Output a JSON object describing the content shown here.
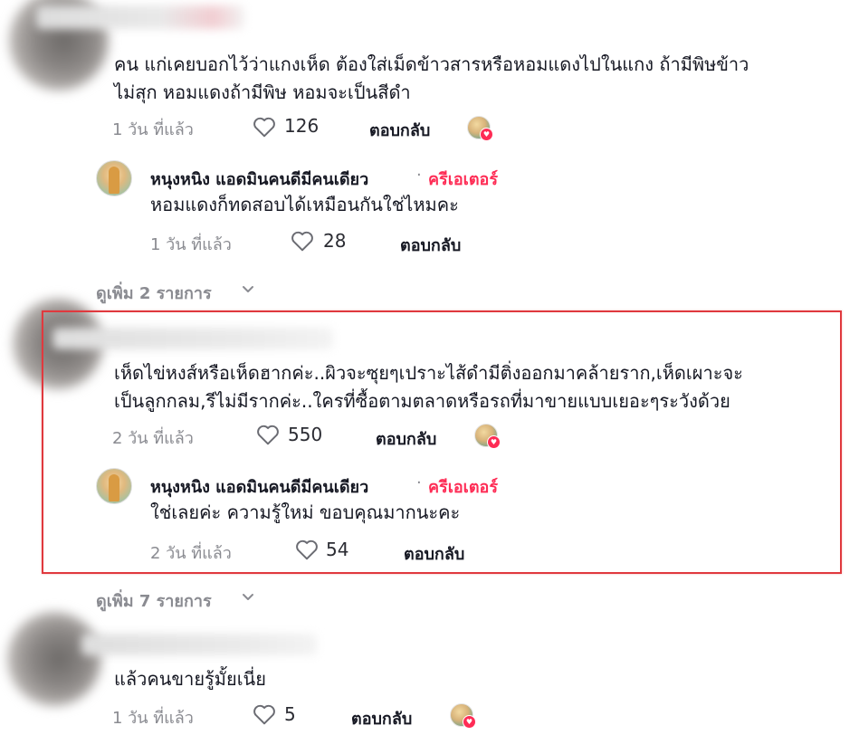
{
  "comments": [
    {
      "text_lines": [
        "คน แก่เคยบอกไว้ว่าแกงเห็ด ต้องใส่เม็ดข้าวสารหรือหอมแดงไปในแกง ถ้ามีพิษข้าว",
        "ไม่สุก หอมแดงถ้ามีพิษ หอมจะเป็นสีดำ"
      ],
      "time": "1 วัน ที่แล้ว",
      "likes": "126",
      "reply_label": "ตอบกลับ",
      "reply": {
        "author": "หนุงหนิง แอดมินคนดีมีคนเดียว",
        "separator": "·",
        "tag": "ครีเอเตอร์",
        "text": "หอมแดงก็ทดสอบได้เหมือนกันใช่ไหมคะ",
        "time": "1 วัน ที่แล้ว",
        "likes": "28",
        "reply_label": "ตอบกลับ"
      },
      "view_more": "ดูเพิ่ม 2 รายการ"
    },
    {
      "text_lines": [
        "เห็ดไข่หงส์หรือเห็ดฮากค่ะ..ผิวจะซุยๆเปราะไส้ดำมีติ่งออกมาคล้ายราก,เห็ดเผาะจะ",
        "เป็นลูกกลม,รีไม่มีรากค่ะ..ใครที่ซื้อตามตลาดหรือรถที่มาขายแบบเยอะๆระวังด้วย"
      ],
      "time": "2 วัน ที่แล้ว",
      "likes": "550",
      "reply_label": "ตอบกลับ",
      "reply": {
        "author": "หนุงหนิง แอดมินคนดีมีคนเดียว",
        "separator": "·",
        "tag": "ครีเอเตอร์",
        "text": "ใช่เลยค่ะ ความรู้ใหม่ ขอบคุณมากนะคะ",
        "time": "2 วัน ที่แล้ว",
        "likes": "54",
        "reply_label": "ตอบกลับ"
      },
      "view_more": "ดูเพิ่ม 7 รายการ"
    },
    {
      "text_lines": [
        "แล้วคนขายรู้มั้ยเนี่ย"
      ],
      "time": "1 วัน ที่แล้ว",
      "likes": "5",
      "reply_label": "ตอบกลับ"
    }
  ],
  "colors": {
    "creator_tag": "#fe2c55",
    "highlight_border": "#e0393e",
    "muted_text": "#8a8b91"
  },
  "icons": {
    "like": "heart-outline-icon",
    "liked_by_creator": "creator-avatar-heart-badge",
    "expand": "chevron-down-icon"
  }
}
